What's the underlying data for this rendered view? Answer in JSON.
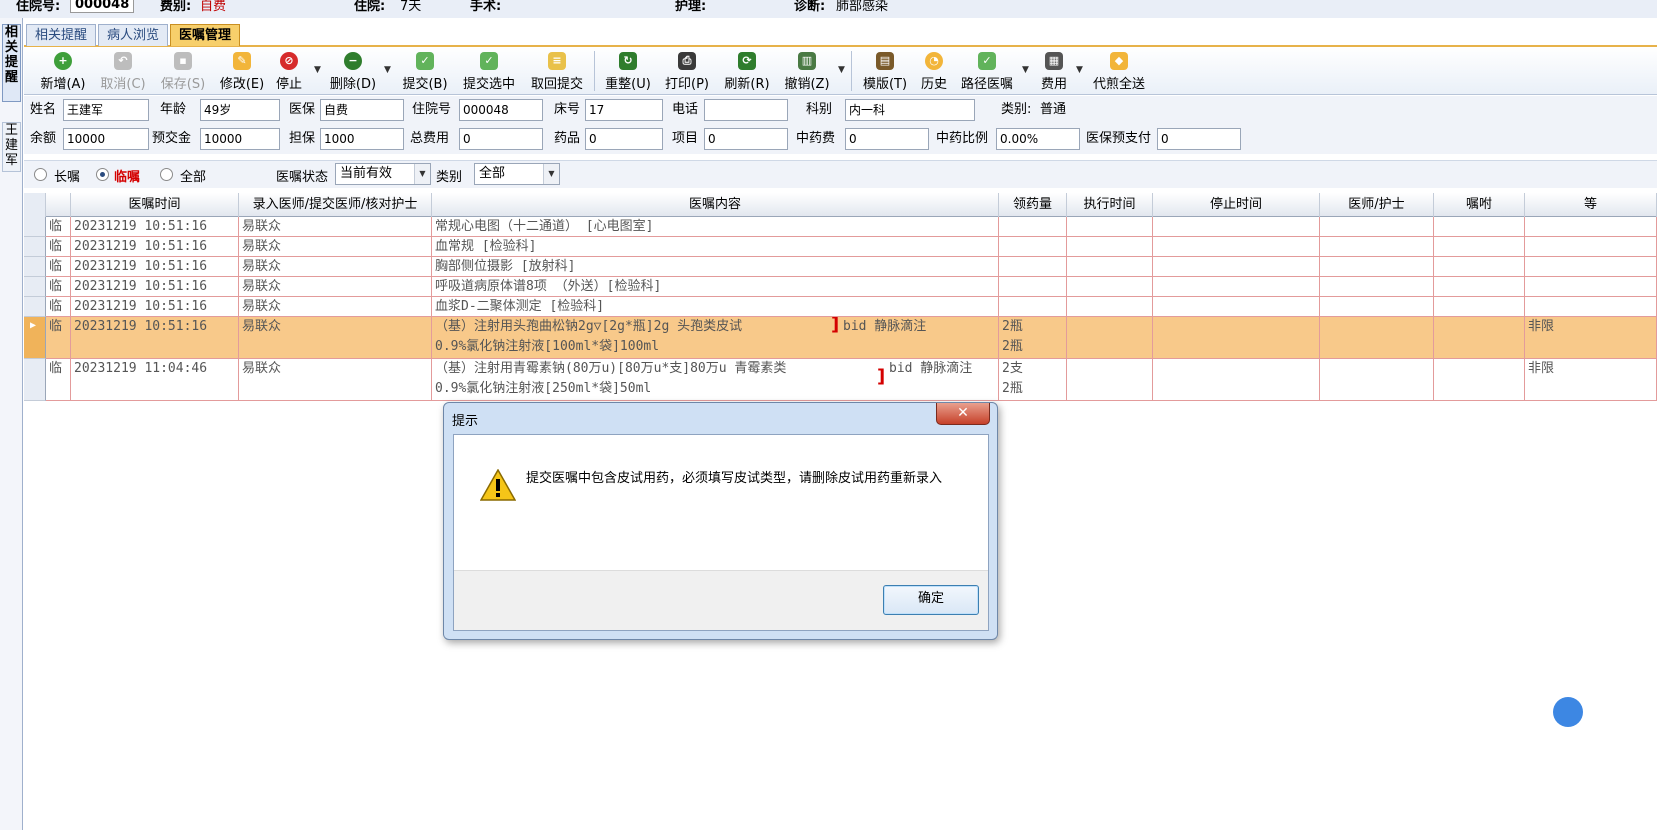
{
  "topbar": {
    "admit_label": "住院号:",
    "admit_value": "000048",
    "fee_label": "费别:",
    "fee_value": "自费",
    "stay_label": "住院:",
    "stay_value": "7天",
    "surgery_label": "手术:",
    "nursing_label": "护理:",
    "diag_label": "诊断:",
    "diag_value": "肺部感染"
  },
  "leftstrip": {
    "tab1": "相关提醒",
    "tab2": "王建军"
  },
  "tabs": [
    "相关提醒",
    "病人浏览",
    "医嘱管理"
  ],
  "toolbar": {
    "new": "新增(A)",
    "cancel": "取消(C)",
    "save": "保存(S)",
    "edit": "修改(E)",
    "stop": "停止",
    "delete": "删除(D)",
    "submit": "提交(B)",
    "submit_sel": "提交选中",
    "withdraw": "取回提交",
    "reorg": "重整(U)",
    "print": "打印(P)",
    "refresh": "刷新(R)",
    "revoke": "撤销(Z)",
    "template": "模版(T)",
    "history": "历史",
    "path": "路径医嘱",
    "fee": "费用",
    "decoct": "代煎全送"
  },
  "patient": {
    "name_label": "姓名",
    "name": "王建军",
    "age_label": "年龄",
    "age": "49岁",
    "ins_label": "医保",
    "ins": "自费",
    "admit_label": "住院号",
    "admit": "000048",
    "bed_label": "床号",
    "bed": "17",
    "phone_label": "电话",
    "phone": "",
    "dept_label": "科别",
    "dept": "内一科",
    "type_label": "类别:",
    "type": "普通",
    "balance_label": "余额",
    "balance": "10000",
    "prepay_label": "预交金",
    "prepay": "10000",
    "guar_label": "担保",
    "guar": "1000",
    "total_label": "总费用",
    "total": "0",
    "drug_label": "药品",
    "drug": "0",
    "item_label": "项目",
    "item": "0",
    "tcm_label": "中药费",
    "tcm": "0",
    "tcm_ratio_label": "中药比例",
    "tcm_ratio": "0.00%",
    "ins_prepay_label": "医保预支付",
    "ins_prepay": "0"
  },
  "filter": {
    "long": "长嘱",
    "temp": "临嘱",
    "all": "全部",
    "status_label": "医嘱状态",
    "status": "当前有效",
    "cat_label": "类别",
    "cat": "全部"
  },
  "grid": {
    "headers": [
      "医嘱时间",
      "录入医师/提交医师/核对护士",
      "医嘱内容",
      "领药量",
      "执行时间",
      "停止时间",
      "医师/护士",
      "嘱咐",
      "等"
    ],
    "rows": [
      {
        "kind": "临",
        "time": "20231219 10:51:16",
        "doctor": "易联众",
        "content": "常规心电图（十二通道）    [心电图室]",
        "content2": "",
        "qty": "",
        "qty2": "",
        "extra": ""
      },
      {
        "kind": "临",
        "time": "20231219 10:51:16",
        "doctor": "易联众",
        "content": "血常规    [检验科]",
        "content2": "",
        "qty": "",
        "qty2": "",
        "extra": ""
      },
      {
        "kind": "临",
        "time": "20231219 10:51:16",
        "doctor": "易联众",
        "content": "胸部侧位摄影    [放射科]",
        "content2": "",
        "qty": "",
        "qty2": "",
        "extra": ""
      },
      {
        "kind": "临",
        "time": "20231219 10:51:16",
        "doctor": "易联众",
        "content": "呼吸道病原体谱8项    （外送）[检验科]",
        "content2": "",
        "qty": "",
        "qty2": "",
        "extra": ""
      },
      {
        "kind": "临",
        "time": "20231219 10:51:16",
        "doctor": "易联众",
        "content": "血浆D-二聚体测定    [检验科]",
        "content2": "",
        "qty": "",
        "qty2": "",
        "extra": ""
      },
      {
        "kind": "临",
        "time": "20231219 10:51:16",
        "doctor": "易联众",
        "content": "（基）注射用头孢曲松钠2g▽[2g*瓶]2g 头孢类皮试",
        "usage": "bid 静脉滴注",
        "content2": "0.9%氯化钠注射液[100ml*袋]100ml",
        "qty": "2瓶",
        "qty2": "2瓶",
        "extra": "非限"
      },
      {
        "kind": "临",
        "time": "20231219 11:04:46",
        "doctor": "易联众",
        "content": "（基）注射用青霉素钠(80万u)[80万u*支]80万u 青霉素类",
        "usage": "bid 静脉滴注",
        "content2": "0.9%氯化钠注射液[250ml*袋]50ml",
        "qty": "2支",
        "qty2": "2瓶",
        "extra": "非限"
      }
    ]
  },
  "dialog": {
    "title": "提示",
    "close": "✕",
    "message": "提交医嘱中包含皮试用药，必须填写皮试类型，请删除皮试用药重新录入",
    "ok": "确定"
  }
}
